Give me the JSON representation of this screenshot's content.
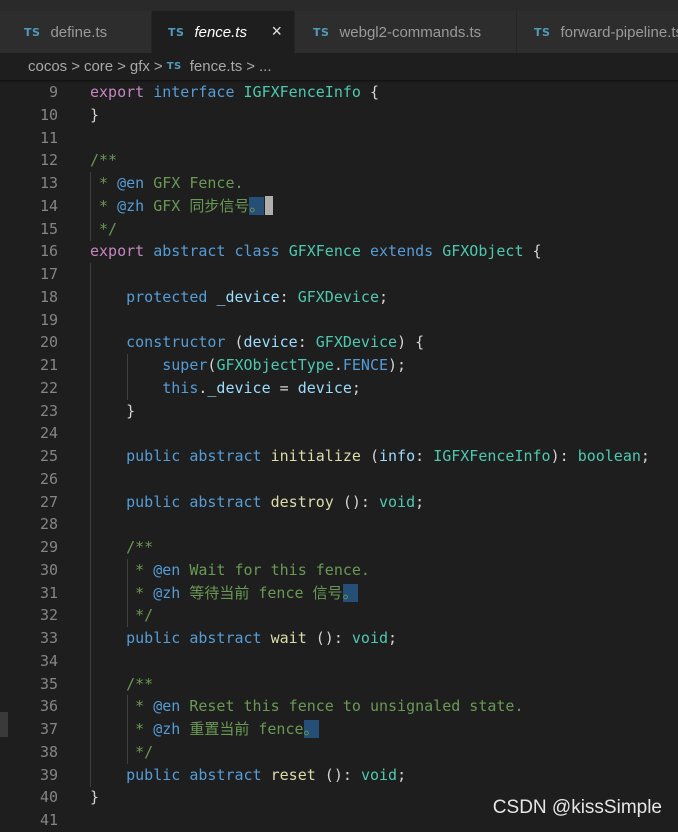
{
  "colors": {
    "keyword": "#569cd6",
    "control": "#c586c0",
    "type": "#4ec9b0",
    "variable": "#9cdcfe",
    "function": "#dcdcaa",
    "comment": "#6a9955",
    "plain": "#d4d4d4",
    "line_number": "#858585",
    "ts_badge": "#519aba"
  },
  "tabs": [
    {
      "badge": "TS",
      "label": "define.ts",
      "active": false
    },
    {
      "badge": "TS",
      "label": "fence.ts",
      "active": true,
      "close_icon": "×"
    },
    {
      "badge": "TS",
      "label": "webgl2-commands.ts",
      "active": false
    },
    {
      "badge": "TS",
      "label": "forward-pipeline.ts",
      "active": false
    }
  ],
  "breadcrumb": {
    "items": [
      "cocos",
      "core",
      "gfx"
    ],
    "file_badge": "TS",
    "file": "fence.ts",
    "more": "...",
    "separator": ">"
  },
  "editor": {
    "lines": [
      {
        "n": "9",
        "tokens": [
          {
            "t": "export",
            "c": "control"
          },
          {
            "t": " "
          },
          {
            "t": "interface",
            "c": "keyword"
          },
          {
            "t": " "
          },
          {
            "t": "IGFXFenceInfo",
            "c": "type"
          },
          {
            "t": " {"
          }
        ]
      },
      {
        "n": "10",
        "tokens": [
          {
            "t": "}"
          }
        ]
      },
      {
        "n": "11",
        "tokens": []
      },
      {
        "n": "12",
        "tokens": [
          {
            "t": "/**",
            "c": "comment"
          }
        ]
      },
      {
        "n": "13",
        "tokens": [
          {
            "t": " * ",
            "c": "comment"
          },
          {
            "t": "@en",
            "c": "keyword"
          },
          {
            "t": " GFX Fence.",
            "c": "comment"
          }
        ]
      },
      {
        "n": "14",
        "tokens": [
          {
            "t": " * ",
            "c": "comment"
          },
          {
            "t": "@zh",
            "c": "keyword"
          },
          {
            "t": " GFX 同步信号",
            "c": "comment"
          },
          {
            "t": "。",
            "c": "comment",
            "hl": true
          },
          {
            "t": "",
            "cursor": true
          }
        ]
      },
      {
        "n": "15",
        "tokens": [
          {
            "t": " */",
            "c": "comment"
          }
        ]
      },
      {
        "n": "16",
        "tokens": [
          {
            "t": "export",
            "c": "control"
          },
          {
            "t": " "
          },
          {
            "t": "abstract",
            "c": "keyword"
          },
          {
            "t": " "
          },
          {
            "t": "class",
            "c": "keyword"
          },
          {
            "t": " "
          },
          {
            "t": "GFXFence",
            "c": "type"
          },
          {
            "t": " "
          },
          {
            "t": "extends",
            "c": "keyword"
          },
          {
            "t": " "
          },
          {
            "t": "GFXObject",
            "c": "type"
          },
          {
            "t": " {"
          }
        ]
      },
      {
        "n": "17",
        "tokens": []
      },
      {
        "n": "18",
        "tokens": [
          {
            "t": "    "
          },
          {
            "t": "protected",
            "c": "keyword"
          },
          {
            "t": " "
          },
          {
            "t": "_device",
            "c": "variable"
          },
          {
            "t": ": "
          },
          {
            "t": "GFXDevice",
            "c": "type"
          },
          {
            "t": ";"
          }
        ]
      },
      {
        "n": "19",
        "tokens": []
      },
      {
        "n": "20",
        "tokens": [
          {
            "t": "    "
          },
          {
            "t": "constructor",
            "c": "keyword"
          },
          {
            "t": " ("
          },
          {
            "t": "device",
            "c": "variable"
          },
          {
            "t": ": "
          },
          {
            "t": "GFXDevice",
            "c": "type"
          },
          {
            "t": ") {"
          }
        ]
      },
      {
        "n": "21",
        "tokens": [
          {
            "t": "        "
          },
          {
            "t": "super",
            "c": "keyword"
          },
          {
            "t": "("
          },
          {
            "t": "GFXObjectType",
            "c": "type"
          },
          {
            "t": "."
          },
          {
            "t": "FENCE",
            "c": "keyword"
          },
          {
            "t": ");"
          }
        ]
      },
      {
        "n": "22",
        "tokens": [
          {
            "t": "        "
          },
          {
            "t": "this",
            "c": "keyword"
          },
          {
            "t": "."
          },
          {
            "t": "_device",
            "c": "variable"
          },
          {
            "t": " = "
          },
          {
            "t": "device",
            "c": "variable"
          },
          {
            "t": ";"
          }
        ]
      },
      {
        "n": "23",
        "tokens": [
          {
            "t": "    }"
          }
        ]
      },
      {
        "n": "24",
        "tokens": []
      },
      {
        "n": "25",
        "tokens": [
          {
            "t": "    "
          },
          {
            "t": "public",
            "c": "keyword"
          },
          {
            "t": " "
          },
          {
            "t": "abstract",
            "c": "keyword"
          },
          {
            "t": " "
          },
          {
            "t": "initialize",
            "c": "function"
          },
          {
            "t": " ("
          },
          {
            "t": "info",
            "c": "variable"
          },
          {
            "t": ": "
          },
          {
            "t": "IGFXFenceInfo",
            "c": "type"
          },
          {
            "t": "): "
          },
          {
            "t": "boolean",
            "c": "type"
          },
          {
            "t": ";"
          }
        ]
      },
      {
        "n": "26",
        "tokens": []
      },
      {
        "n": "27",
        "tokens": [
          {
            "t": "    "
          },
          {
            "t": "public",
            "c": "keyword"
          },
          {
            "t": " "
          },
          {
            "t": "abstract",
            "c": "keyword"
          },
          {
            "t": " "
          },
          {
            "t": "destroy",
            "c": "function"
          },
          {
            "t": " (): "
          },
          {
            "t": "void",
            "c": "type"
          },
          {
            "t": ";"
          }
        ]
      },
      {
        "n": "28",
        "tokens": []
      },
      {
        "n": "29",
        "tokens": [
          {
            "t": "    "
          },
          {
            "t": "/**",
            "c": "comment"
          }
        ]
      },
      {
        "n": "30",
        "tokens": [
          {
            "t": "    "
          },
          {
            "t": " * ",
            "c": "comment"
          },
          {
            "t": "@en",
            "c": "keyword"
          },
          {
            "t": " Wait for this fence.",
            "c": "comment"
          }
        ]
      },
      {
        "n": "31",
        "tokens": [
          {
            "t": "    "
          },
          {
            "t": " * ",
            "c": "comment"
          },
          {
            "t": "@zh",
            "c": "keyword"
          },
          {
            "t": " 等待当前 fence 信号",
            "c": "comment"
          },
          {
            "t": "。",
            "c": "comment",
            "hl": true
          }
        ]
      },
      {
        "n": "32",
        "tokens": [
          {
            "t": "    "
          },
          {
            "t": " */",
            "c": "comment"
          }
        ]
      },
      {
        "n": "33",
        "tokens": [
          {
            "t": "    "
          },
          {
            "t": "public",
            "c": "keyword"
          },
          {
            "t": " "
          },
          {
            "t": "abstract",
            "c": "keyword"
          },
          {
            "t": " "
          },
          {
            "t": "wait",
            "c": "function"
          },
          {
            "t": " (): "
          },
          {
            "t": "void",
            "c": "type"
          },
          {
            "t": ";"
          }
        ]
      },
      {
        "n": "34",
        "tokens": []
      },
      {
        "n": "35",
        "tokens": [
          {
            "t": "    "
          },
          {
            "t": "/**",
            "c": "comment"
          }
        ]
      },
      {
        "n": "36",
        "tokens": [
          {
            "t": "    "
          },
          {
            "t": " * ",
            "c": "comment"
          },
          {
            "t": "@en",
            "c": "keyword"
          },
          {
            "t": " Reset this fence to unsignaled state.",
            "c": "comment"
          }
        ]
      },
      {
        "n": "37",
        "tokens": [
          {
            "t": "    "
          },
          {
            "t": " * ",
            "c": "comment"
          },
          {
            "t": "@zh",
            "c": "keyword"
          },
          {
            "t": " 重置当前 fence",
            "c": "comment"
          },
          {
            "t": "。",
            "c": "comment",
            "hl": true
          }
        ]
      },
      {
        "n": "38",
        "tokens": [
          {
            "t": "    "
          },
          {
            "t": " */",
            "c": "comment"
          }
        ]
      },
      {
        "n": "39",
        "tokens": [
          {
            "t": "    "
          },
          {
            "t": "public",
            "c": "keyword"
          },
          {
            "t": " "
          },
          {
            "t": "abstract",
            "c": "keyword"
          },
          {
            "t": " "
          },
          {
            "t": "reset",
            "c": "function"
          },
          {
            "t": " (): "
          },
          {
            "t": "void",
            "c": "type"
          },
          {
            "t": ";"
          }
        ]
      },
      {
        "n": "40",
        "tokens": [
          {
            "t": "}"
          }
        ]
      },
      {
        "n": "41",
        "tokens": []
      }
    ]
  },
  "watermark": "CSDN @kissSimple"
}
